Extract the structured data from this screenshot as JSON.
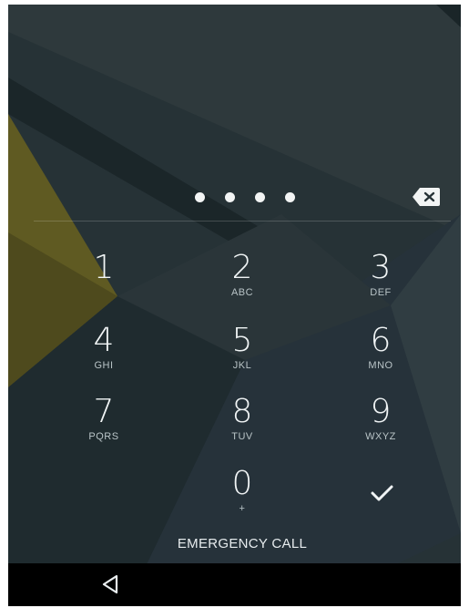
{
  "pin": {
    "entered_digits": 4
  },
  "keypad": [
    {
      "digit": "1",
      "letters": ""
    },
    {
      "digit": "2",
      "letters": "ABC"
    },
    {
      "digit": "3",
      "letters": "DEF"
    },
    {
      "digit": "4",
      "letters": "GHI"
    },
    {
      "digit": "5",
      "letters": "JKL"
    },
    {
      "digit": "6",
      "letters": "MNO"
    },
    {
      "digit": "7",
      "letters": "PQRS"
    },
    {
      "digit": "8",
      "letters": "TUV"
    },
    {
      "digit": "9",
      "letters": "WXYZ"
    },
    {
      "digit": "0",
      "letters": "+"
    }
  ],
  "actions": {
    "emergency_call": "EMERGENCY CALL",
    "backspace_icon": "backspace-icon",
    "enter_icon": "checkmark-icon"
  },
  "navigation": {
    "back_icon": "back-triangle-icon"
  },
  "colors": {
    "background": "#263236",
    "text": "#f0f4f5",
    "subtext": "#b9c4c7",
    "accent_olive": "#5f5a22",
    "navbar": "#000000"
  }
}
